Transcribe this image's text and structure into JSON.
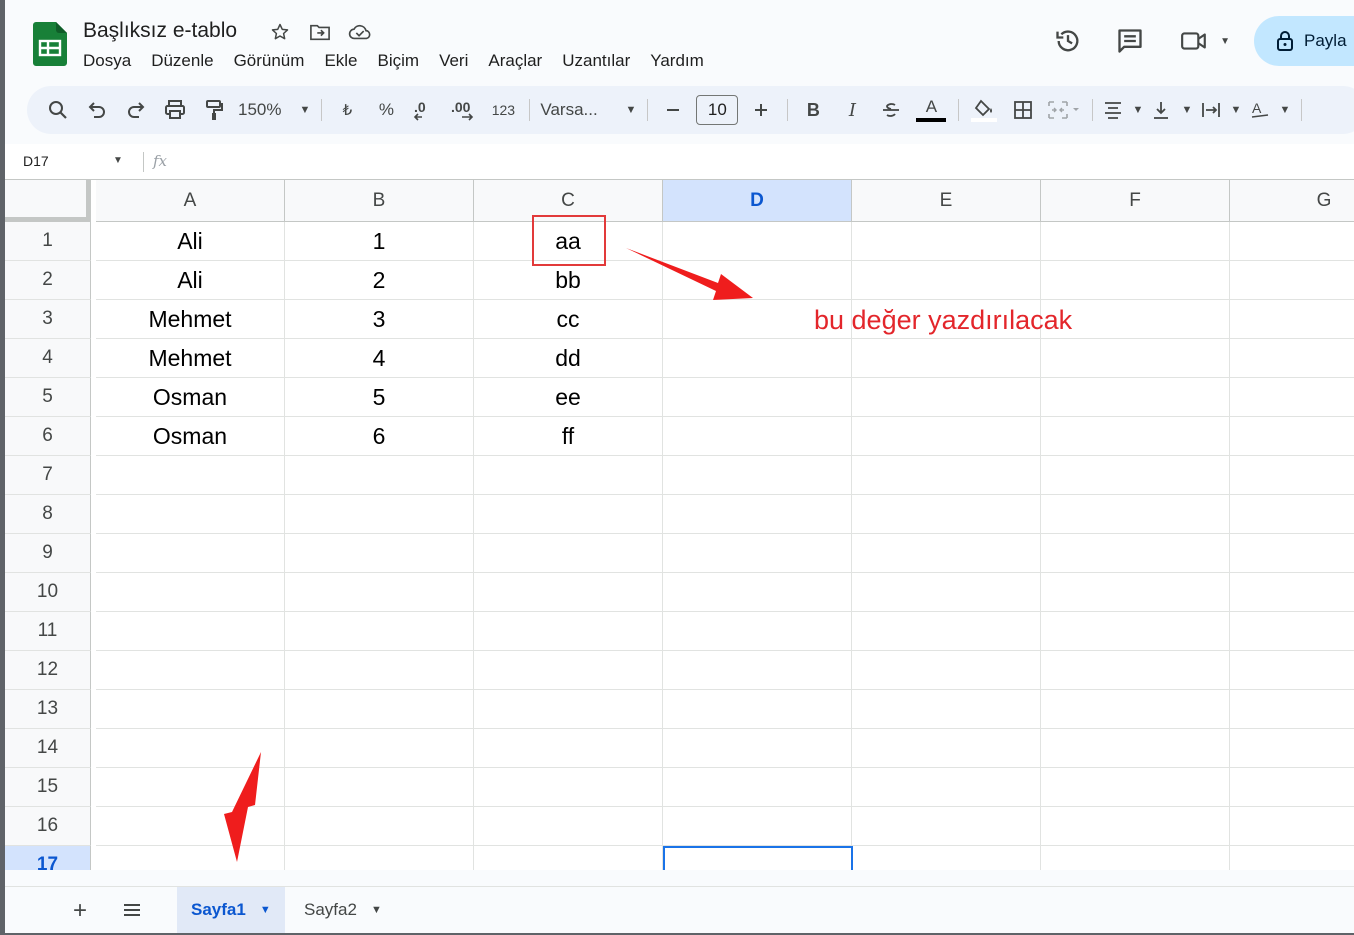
{
  "doc": {
    "title": "Başlıksız e-tablo",
    "brand_color": "#188038"
  },
  "menu": [
    "Dosya",
    "Düzenle",
    "Görünüm",
    "Ekle",
    "Biçim",
    "Veri",
    "Araçlar",
    "Uzantılar",
    "Yardım"
  ],
  "header": {
    "share_label": "Payla"
  },
  "toolbar": {
    "zoom": "150%",
    "currency": "₺",
    "percent": "%",
    "number_format": "123",
    "font": "Varsa...",
    "font_size": "10",
    "bold": "B",
    "italic": "I",
    "text_color_letter": "A",
    "text_color": "#000000"
  },
  "formula_bar": {
    "name_box": "D17",
    "fx": "fx"
  },
  "grid": {
    "columns": [
      "A",
      "B",
      "C",
      "D",
      "E",
      "F",
      "G"
    ],
    "selected_column": "D",
    "rows": [
      "1",
      "2",
      "3",
      "4",
      "5",
      "6",
      "7",
      "8",
      "9",
      "10",
      "11",
      "12",
      "13",
      "14",
      "15",
      "16",
      "17"
    ],
    "selected_row": "17",
    "active_cell": "D17",
    "cells": [
      [
        "Ali",
        "1",
        "aa"
      ],
      [
        "Ali",
        "2",
        "bb"
      ],
      [
        "Mehmet",
        "3",
        "cc"
      ],
      [
        "Mehmet",
        "4",
        "dd"
      ],
      [
        "Osman",
        "5",
        "ee"
      ],
      [
        "Osman",
        "6",
        "ff"
      ]
    ]
  },
  "annotation": {
    "text": "bu değer yazdırılacak",
    "color": "#e3262b"
  },
  "sheets": {
    "tabs": [
      "Sayfa1",
      "Sayfa2"
    ],
    "active": "Sayfa1"
  }
}
